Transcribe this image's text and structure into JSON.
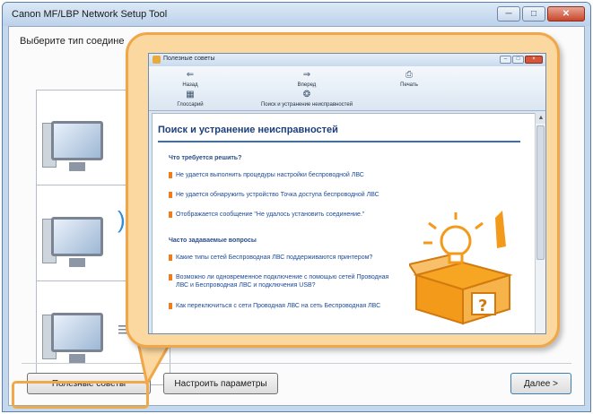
{
  "window": {
    "title": "Canon MF/LBP Network Setup Tool",
    "controls": {
      "minimize_icon": "minimize-icon",
      "maximize_icon": "maximize-icon",
      "close_icon": "close-icon"
    }
  },
  "main": {
    "instruction": "Выберите тип соедине",
    "options": [
      {
        "name": "wired-lan-option",
        "connector_icon": "network-cable-icon"
      },
      {
        "name": "wireless-lan-option",
        "connector_icon": "wireless-waves-icon"
      },
      {
        "name": "usb-option",
        "connector_icon": "usb-cable-icon"
      }
    ]
  },
  "buttons": {
    "tips": "Полезные советы",
    "settings": "Настроить параметры",
    "next": "Далее >"
  },
  "help_window": {
    "title": "Полезные советы",
    "toolbar": [
      {
        "label": "Назад",
        "icon": "back-arrow-icon"
      },
      {
        "label": "Вперед",
        "icon": "forward-arrow-icon"
      },
      {
        "label": "Печать",
        "icon": "print-icon"
      },
      {
        "label": "Глоссарий",
        "icon": "glossary-icon"
      },
      {
        "label": "Поиск и устранение неисправностей",
        "icon": "troubleshooting-icon"
      }
    ],
    "heading": "Поиск и устранение неисправностей",
    "section1": {
      "title": "Что требуется решить?",
      "items": [
        "Не удается выполнить процедуры настройки беспроводной ЛВС",
        "Не удается обнаружить устройство Точка доступа беспроводной ЛВС",
        "Отображается сообщение \"Не удалось установить соединение.\""
      ]
    },
    "section2": {
      "title": "Часто задаваемые вопросы",
      "items": [
        "Какие типы сетей Беспроводная ЛВС поддерживаются принтером?",
        "Возможно ли одновременное подключение с помощью сетей Проводная ЛВС и Беспроводная ЛВС и подключения USB?",
        "Как переключиться с сети Проводная ЛВС на сеть Беспроводная ЛВС"
      ]
    },
    "illustration": "lightbulb-toolbox-icon"
  },
  "colors": {
    "accent_orange": "#efa74a",
    "callout_fill": "#fbd8a0",
    "link_blue": "#1a4a9c",
    "heading_blue": "#1c3f7a"
  }
}
